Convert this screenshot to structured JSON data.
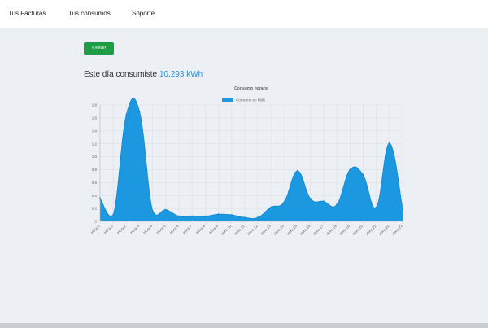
{
  "nav": {
    "items": [
      {
        "label": "Tus Facturas"
      },
      {
        "label": "Tus consumos"
      },
      {
        "label": "Soporte"
      }
    ]
  },
  "back_button": {
    "label": "« volver",
    "color": "#1f9d45"
  },
  "summary": {
    "text": "Este día consumiste",
    "value": "10.293 kWh",
    "value_color": "#2f8fd8"
  },
  "chart_data": {
    "type": "area",
    "title": "Consumo horario",
    "legend": [
      "Consumo en kWh"
    ],
    "legend_position": "top",
    "grid": true,
    "fill_color": "#1b98e0",
    "ylim": [
      0,
      1.8
    ],
    "yticks": [
      0,
      0.2,
      0.4,
      0.6,
      0.8,
      1.0,
      1.2,
      1.4,
      1.6,
      1.8
    ],
    "yticklabels": [
      "0",
      "0.2",
      "0.4",
      "0.6",
      "0.8",
      "1.0",
      "1.2",
      "1.4",
      "1.6",
      "1.8"
    ],
    "categories": [
      "Hora 0",
      "Hora 1",
      "Hora 2",
      "Hora 3",
      "Hora 4",
      "Hora 5",
      "Hora 6",
      "Hora 7",
      "Hora 8",
      "Hora 9",
      "Hora 10",
      "Hora 11",
      "Hora 12",
      "Hora 13",
      "Hora 14",
      "Hora 15",
      "Hora 16",
      "Hora 17",
      "Hora 18",
      "Hora 19",
      "Hora 20",
      "Hora 21",
      "Hora 22",
      "Hora 23"
    ],
    "series": [
      {
        "name": "Consumo en kWh",
        "values": [
          0.36,
          0.1,
          1.65,
          1.7,
          0.16,
          0.18,
          0.08,
          0.08,
          0.08,
          0.11,
          0.1,
          0.06,
          0.06,
          0.22,
          0.3,
          0.78,
          0.35,
          0.31,
          0.26,
          0.8,
          0.72,
          0.22,
          1.21,
          0.2
        ]
      }
    ]
  }
}
